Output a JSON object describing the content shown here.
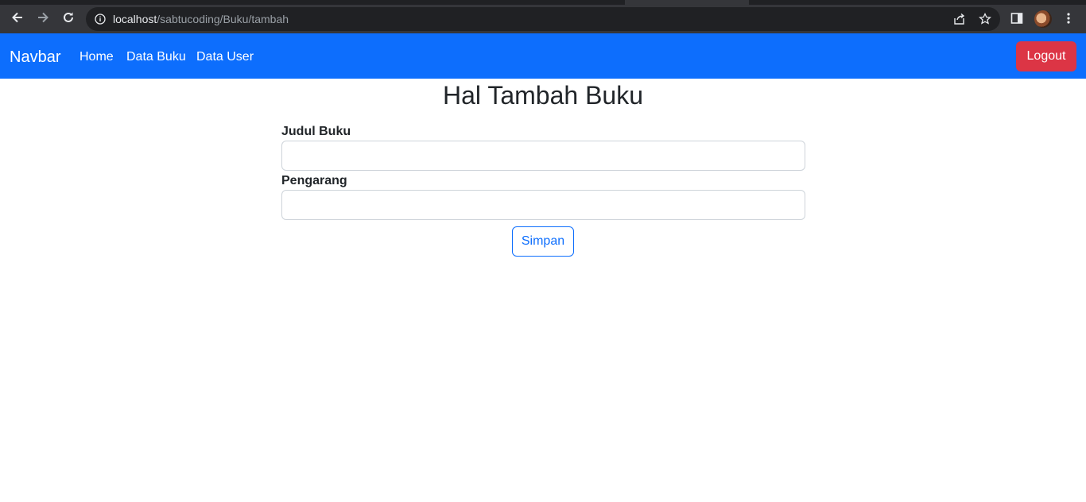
{
  "browser": {
    "url_host": "localhost",
    "url_path": "/sabtucoding/Buku/tambah"
  },
  "navbar": {
    "brand": "Navbar",
    "links": [
      "Home",
      "Data Buku",
      "Data User"
    ],
    "logout_label": "Logout"
  },
  "page": {
    "title": "Hal Tambah Buku"
  },
  "form": {
    "judul_label": "Judul Buku",
    "judul_value": "",
    "pengarang_label": "Pengarang",
    "pengarang_value": "",
    "submit_label": "Simpan"
  },
  "colors": {
    "navbar_bg": "#0d6efd",
    "logout_bg": "#dc3545",
    "primary_outline": "#0d6efd"
  }
}
